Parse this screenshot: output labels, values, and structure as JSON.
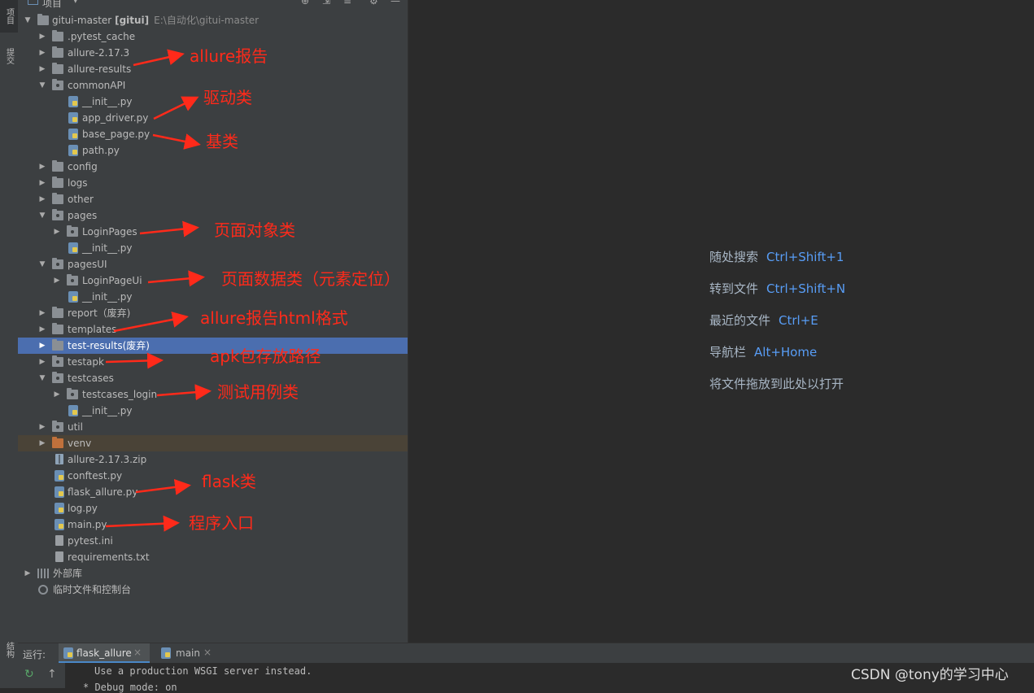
{
  "left_strip": {
    "project_tab": "项目",
    "commit_tab": "提交",
    "structure_tab": "结构"
  },
  "panel_header": {
    "title": "项目",
    "dropdown": "▾"
  },
  "tree": {
    "root": {
      "name": "gitui-master",
      "module": "[gitui]",
      "path": "E:\\自动化\\gitui-master"
    },
    "items": [
      {
        "label": ".pytest_cache"
      },
      {
        "label": "allure-2.17.3"
      },
      {
        "label": "allure-results"
      },
      {
        "label": "commonAPI"
      },
      {
        "label": "__init__.py"
      },
      {
        "label": "app_driver.py"
      },
      {
        "label": "base_page.py"
      },
      {
        "label": "path.py"
      },
      {
        "label": "config"
      },
      {
        "label": "logs"
      },
      {
        "label": "other"
      },
      {
        "label": "pages"
      },
      {
        "label": "LoginPages"
      },
      {
        "label": "__init__.py"
      },
      {
        "label": "pagesUI"
      },
      {
        "label": "LoginPageUi"
      },
      {
        "label": "__init__.py"
      },
      {
        "label": "report（废弃)"
      },
      {
        "label": "templates"
      },
      {
        "label": "test-results(废弃)"
      },
      {
        "label": "testapk"
      },
      {
        "label": "testcases"
      },
      {
        "label": "testcases_login"
      },
      {
        "label": "__init__.py"
      },
      {
        "label": "util"
      },
      {
        "label": "venv"
      },
      {
        "label": "allure-2.17.3.zip"
      },
      {
        "label": "conftest.py"
      },
      {
        "label": "flask_allure.py"
      },
      {
        "label": "log.py"
      },
      {
        "label": "main.py"
      },
      {
        "label": "pytest.ini"
      },
      {
        "label": "requirements.txt"
      },
      {
        "label": "外部库"
      },
      {
        "label": "临时文件和控制台"
      }
    ]
  },
  "annotations": {
    "allure_report": "allure报告",
    "driver": "驱动类",
    "base": "基类",
    "page_object": "页面对象类",
    "page_data": "页面数据类（元素定位）",
    "allure_html": "allure报告html格式",
    "apk_path": "apk包存放路径",
    "test_cases": "测试用例类",
    "flask": "flask类",
    "entry": "程序入口"
  },
  "annotation_color": "#ff2a1a",
  "editor_hints": [
    {
      "text": "随处搜索",
      "key": "Ctrl+Shift+1"
    },
    {
      "text": "转到文件",
      "key": "Ctrl+Shift+N"
    },
    {
      "text": "最近的文件",
      "key": "Ctrl+E"
    },
    {
      "text": "导航栏",
      "key": "Alt+Home"
    },
    {
      "text": "将文件拖放到此处以打开",
      "key": ""
    }
  ],
  "run_bar": {
    "label": "运行:",
    "tabs": [
      {
        "label": "flask_allure"
      },
      {
        "label": "main"
      }
    ]
  },
  "console": {
    "line1": "Use a production WSGI server instead.",
    "line2": "* Debug mode: on"
  },
  "watermark": "CSDN @tony的学习中心",
  "colors": {
    "selection": "#4b6eaf",
    "panel": "#3c3f41",
    "editor": "#2b2b2b",
    "key": "#589df6"
  }
}
